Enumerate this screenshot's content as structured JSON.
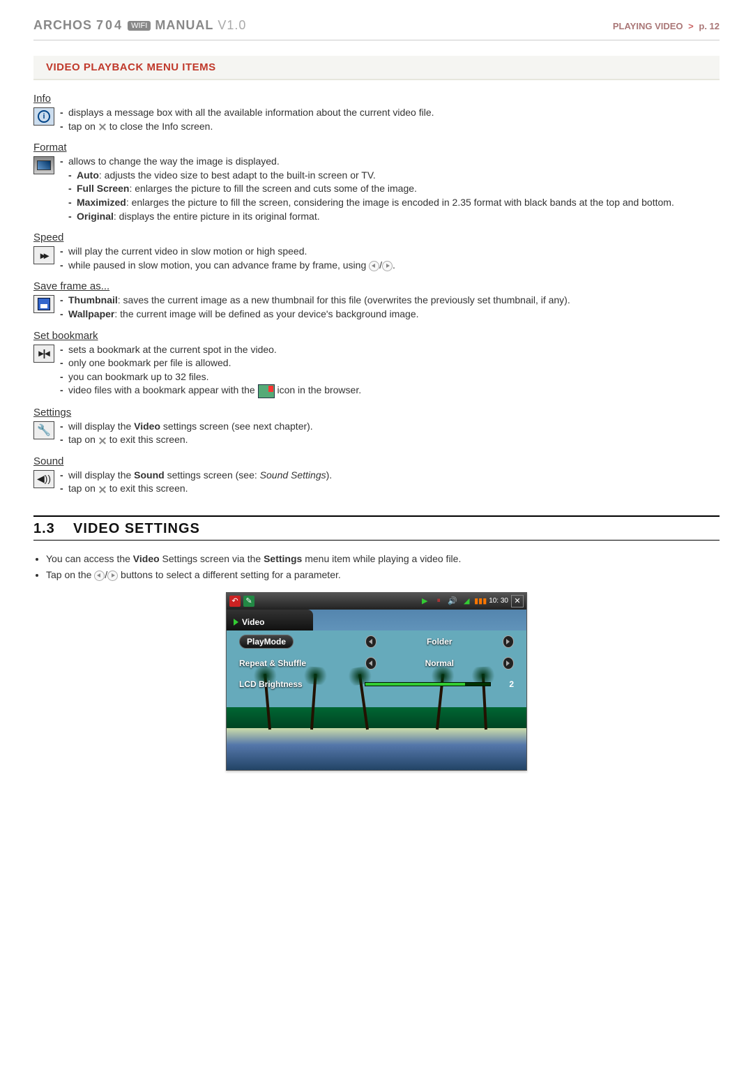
{
  "header": {
    "brand": "ARCHOS",
    "model_number": "704",
    "badge": "WIFI",
    "manual_label": "MANUAL",
    "version": "V1.0",
    "section_label": "PLAYING VIDEO",
    "page_label": "p. 12"
  },
  "menu_section": {
    "title": "VIDEO PLAYBACK MENU ITEMS",
    "items": {
      "info": {
        "title": "Info",
        "line1": "displays a message box with all the available information about the current video file.",
        "line2a": "tap on ",
        "line2b": " to close the Info screen."
      },
      "format": {
        "title": "Format",
        "line1": "allows to change the way the image is displayed.",
        "auto_label": "Auto",
        "auto_text": ": adjusts the video size to best adapt to the built-in screen or TV.",
        "full_label": "Full Screen",
        "full_text": ": enlarges the picture to fill the screen and cuts some of the image.",
        "max_label": "Maximized",
        "max_text": ": enlarges the picture to fill the screen, considering the image is encoded in 2.35 format with black bands at the top and bottom.",
        "orig_label": "Original",
        "orig_text": ": displays the entire picture in its original format."
      },
      "speed": {
        "title": "Speed",
        "line1": "will play the current video in slow motion or high speed.",
        "line2a": "while paused in slow motion, you can advance frame by frame, using ",
        "line2b": "."
      },
      "save": {
        "title": "Save frame as...",
        "thumb_label": "Thumbnail",
        "thumb_text": ": saves the current image as a new thumbnail for this file (overwrites the previously set thumbnail, if any).",
        "wall_label": "Wallpaper",
        "wall_text": ": the current image will be defined as your device's background image."
      },
      "bookmark": {
        "title": "Set bookmark",
        "line1": "sets a bookmark at the current spot in the video.",
        "line2": "only one bookmark per file is allowed.",
        "line3": "you can bookmark up to 32 files.",
        "line4a": "video files with a bookmark appear with the ",
        "line4b": " icon in the browser."
      },
      "settings": {
        "title": "Settings",
        "line1a": "will display the ",
        "line1b": "Video",
        "line1c": " settings screen (see next chapter).",
        "line2a": "tap on ",
        "line2b": " to exit this screen."
      },
      "sound": {
        "title": "Sound",
        "line1a": "will display the ",
        "line1b": "Sound",
        "line1c": " settings screen (see: ",
        "line1d": "Sound Settings",
        "line1e": ").",
        "line2a": "tap on ",
        "line2b": " to exit this screen."
      }
    }
  },
  "video_settings_section": {
    "number": "1.3",
    "title": "VIDEO SETTINGS",
    "bullet1a": "You can access the ",
    "bullet1b": "Video",
    "bullet1c": " Settings screen via the ",
    "bullet1d": "Settings",
    "bullet1e": " menu item while playing a video file.",
    "bullet2a": "Tap on the ",
    "bullet2b": " buttons to select a different setting for a parameter."
  },
  "screenshot": {
    "tab_label": "Video",
    "time": "10: 30",
    "playmode_label": "PlayMode",
    "playmode_value": "Folder",
    "repeat_label": "Repeat & Shuffle",
    "repeat_value": "Normal",
    "brightness_label": "LCD Brightness",
    "brightness_value": "2"
  }
}
